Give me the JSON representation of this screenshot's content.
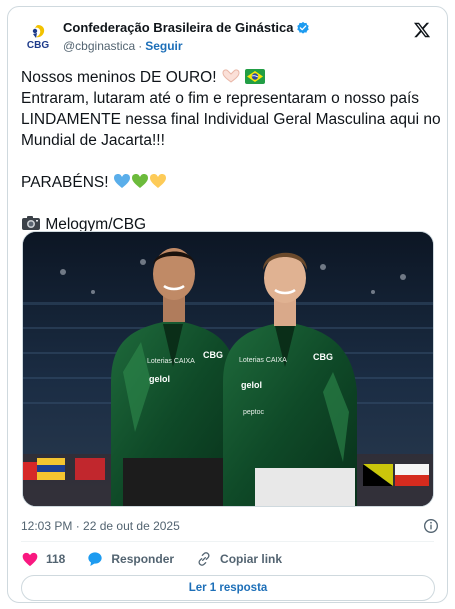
{
  "account": {
    "display_name": "Confederação Brasileira de Ginástica",
    "handle": "@cbginastica",
    "separator": "·",
    "follow_label": "Seguir",
    "avatar_text": "CBG"
  },
  "tweet": {
    "line1": "Nossos meninos DE OURO!",
    "line2": "Entraram, lutaram até o fim e representaram o nosso país LINDAMENTE nessa final Individual Geral Masculina aqui no Mundial de Jacarta!!!",
    "line3": "PARABÉNS!",
    "line4": "Melogym/CBG"
  },
  "photo": {
    "jacket_logo": "CBG",
    "sponsor1": "Loterias CAIXA",
    "sponsor2": "gelol",
    "sponsor3": "peptoc"
  },
  "meta": {
    "timestamp": "12:03 PM · 22 de out de 2025"
  },
  "actions": {
    "like_count": "118",
    "reply_label": "Responder",
    "copy_label": "Copiar link"
  },
  "footer": {
    "read_replies": "Ler 1 resposta"
  },
  "colors": {
    "accent": "#1d6fb8",
    "like": "#f91880",
    "verified": "#1d9bf0",
    "muted": "#536471"
  }
}
